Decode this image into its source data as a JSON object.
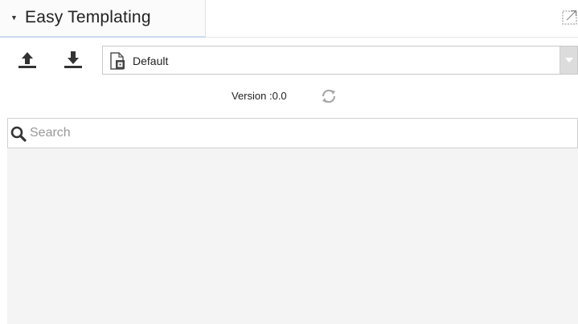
{
  "panel": {
    "tab_title": "Easy Templating",
    "tab_caret_icon": "caret-down-icon",
    "popout_icon": "popout-window-icon"
  },
  "toolbar": {
    "upload_icon": "upload-icon",
    "download_icon": "download-icon",
    "template_select": {
      "value": "Default",
      "icon": "template-document-icon"
    }
  },
  "version": {
    "text": "Version :0.0",
    "refresh_icon": "refresh-icon"
  },
  "search": {
    "placeholder": "Search",
    "value": ""
  },
  "colors": {
    "tab_underline": "#c9dcef",
    "icon": "#333333",
    "results_background": "#f4f4f4"
  }
}
